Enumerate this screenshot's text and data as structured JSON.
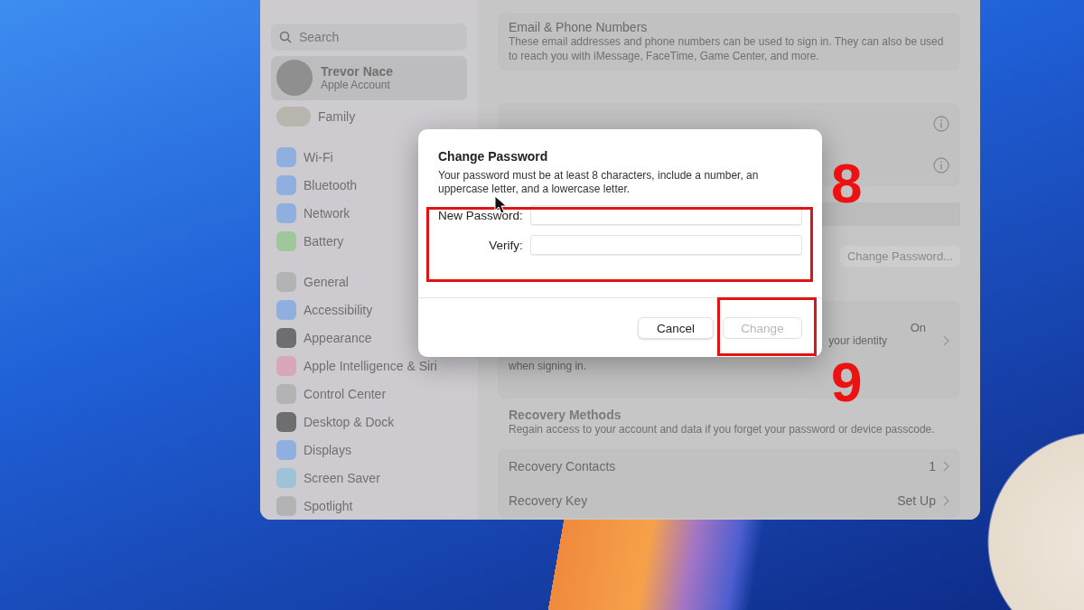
{
  "sidebar": {
    "search": {
      "placeholder": "Search"
    },
    "account": {
      "name": "Trevor Nace",
      "subtitle": "Apple Account",
      "selected": true
    },
    "groups": [
      [
        {
          "label": "Family",
          "kind": "family",
          "color": "#b8b4ae"
        }
      ],
      [
        {
          "label": "Wi-Fi",
          "kind": "setting",
          "color": "#8fb0df"
        },
        {
          "label": "Bluetooth",
          "kind": "setting",
          "color": "#8fb0df"
        },
        {
          "label": "Network",
          "kind": "setting",
          "color": "#8fb0df"
        },
        {
          "label": "Battery",
          "kind": "setting",
          "color": "#9fc79b"
        }
      ],
      [
        {
          "label": "General",
          "kind": "setting",
          "color": "#b3b3b3"
        },
        {
          "label": "Accessibility",
          "kind": "setting",
          "color": "#8fb0df"
        },
        {
          "label": "Appearance",
          "kind": "setting",
          "color": "#6e6e6e"
        },
        {
          "label": "Apple Intelligence & Siri",
          "kind": "setting",
          "color": "#d7a7b9"
        },
        {
          "label": "Control Center",
          "kind": "setting",
          "color": "#b3b3b3"
        },
        {
          "label": "Desktop & Dock",
          "kind": "setting",
          "color": "#6e6e6e"
        },
        {
          "label": "Displays",
          "kind": "setting",
          "color": "#8fb0df"
        },
        {
          "label": "Screen Saver",
          "kind": "setting",
          "color": "#9ec3d6"
        },
        {
          "label": "Spotlight",
          "kind": "setting",
          "color": "#b3b3b3"
        }
      ]
    ]
  },
  "main": {
    "email_card": {
      "title": "Email & Phone Numbers",
      "description": "These email addresses and phone numbers can be used to sign in. They can also be used to reach you with iMessage, FaceTime, Game Center, and more."
    },
    "password_button": "Change Password...",
    "two_factor": {
      "status": "On",
      "text_1": "your identity",
      "text_2": "when signing in."
    },
    "recovery": {
      "title": "Recovery Methods",
      "description": "Regain access to your account and data if you forget your password or device passcode.",
      "rows": [
        {
          "label": "Recovery Contacts",
          "value": "1"
        },
        {
          "label": "Recovery Key",
          "value": "Set Up"
        }
      ]
    }
  },
  "dialog": {
    "title": "Change Password",
    "message": "Your password must be at least 8 characters, include a number, an uppercase letter, and a lowercase letter.",
    "fields": [
      {
        "label": "New Password:"
      },
      {
        "label": "Verify:"
      }
    ],
    "buttons": [
      {
        "label": "Cancel",
        "disabled": false
      },
      {
        "label": "Change",
        "disabled": true
      }
    ]
  },
  "annotations": [
    {
      "number": "8"
    },
    {
      "number": "9"
    }
  ]
}
